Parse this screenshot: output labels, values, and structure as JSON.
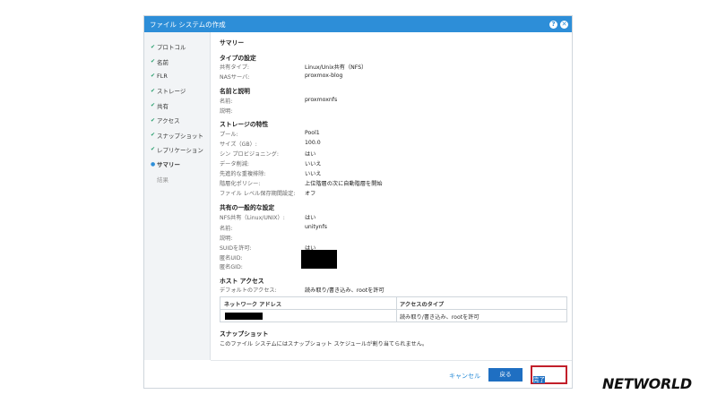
{
  "window": {
    "title": "ファイル システムの作成"
  },
  "sidebar": {
    "steps": [
      {
        "label": "プロトコル",
        "state": "done"
      },
      {
        "label": "名前",
        "state": "done"
      },
      {
        "label": "FLR",
        "state": "done"
      },
      {
        "label": "ストレージ",
        "state": "done"
      },
      {
        "label": "共有",
        "state": "done"
      },
      {
        "label": "アクセス",
        "state": "done"
      },
      {
        "label": "スナップショット",
        "state": "done"
      },
      {
        "label": "レプリケーション",
        "state": "done"
      },
      {
        "label": "サマリー",
        "state": "current"
      },
      {
        "label": "結果",
        "state": "future"
      }
    ]
  },
  "summary": {
    "title": "サマリー",
    "type": {
      "heading": "タイプの設定",
      "share_type_label": "共有タイプ:",
      "share_type_value": "Linux/Unix共有（NFS）",
      "nas_label": "NASサーバ:",
      "nas_value": "proxmox-blog"
    },
    "name": {
      "heading": "名前と説明",
      "name_label": "名前:",
      "name_value": "proxmoxnfs",
      "desc_label": "説明:"
    },
    "storage": {
      "heading": "ストレージの特性",
      "pool_label": "プール:",
      "pool_value": "Pool1",
      "size_label": "サイズ（GB）:",
      "size_value": "100.0",
      "thin_label": "シン プロビジョニング:",
      "thin_value": "はい",
      "compress_label": "データ削減:",
      "compress_value": "いいえ",
      "dedup_label": "先進的な重複排除:",
      "dedup_value": "いいえ",
      "tier_label": "階層化ポリシー:",
      "tier_value": "上位階層の次に自動階層を開始",
      "flr_label": "ファイル レベル保存期間設定:",
      "flr_value": "オフ"
    },
    "share": {
      "heading": "共有の一般的な設定",
      "nfs_label": "NFS共有（Linux/UNIX）:",
      "nfs_value": "はい",
      "name_label": "名前:",
      "name_value": "unitynfs",
      "desc_label": "説明:",
      "suid_label": "SUIDを許可:",
      "suid_value": "はい",
      "anon_uid_label": "匿名UID:",
      "anon_gid_label": "匿名GID:"
    },
    "host": {
      "heading": "ホスト アクセス",
      "default_label": "デフォルトのアクセス:",
      "default_value": "読み取り/書き込み、rootを許可",
      "col_network": "ネットワーク アドレス",
      "col_access": "アクセスのタイプ",
      "row_access": "読み取り/書き込み、rootを許可"
    },
    "snapshot": {
      "heading": "スナップショット",
      "text": "このファイル システムにはスナップショット スケジュールが割り当てられません。"
    }
  },
  "footer": {
    "cancel": "キャンセル",
    "back": "戻る",
    "finish": "完了"
  },
  "brand": {
    "logo_text": "NETWORLD"
  }
}
